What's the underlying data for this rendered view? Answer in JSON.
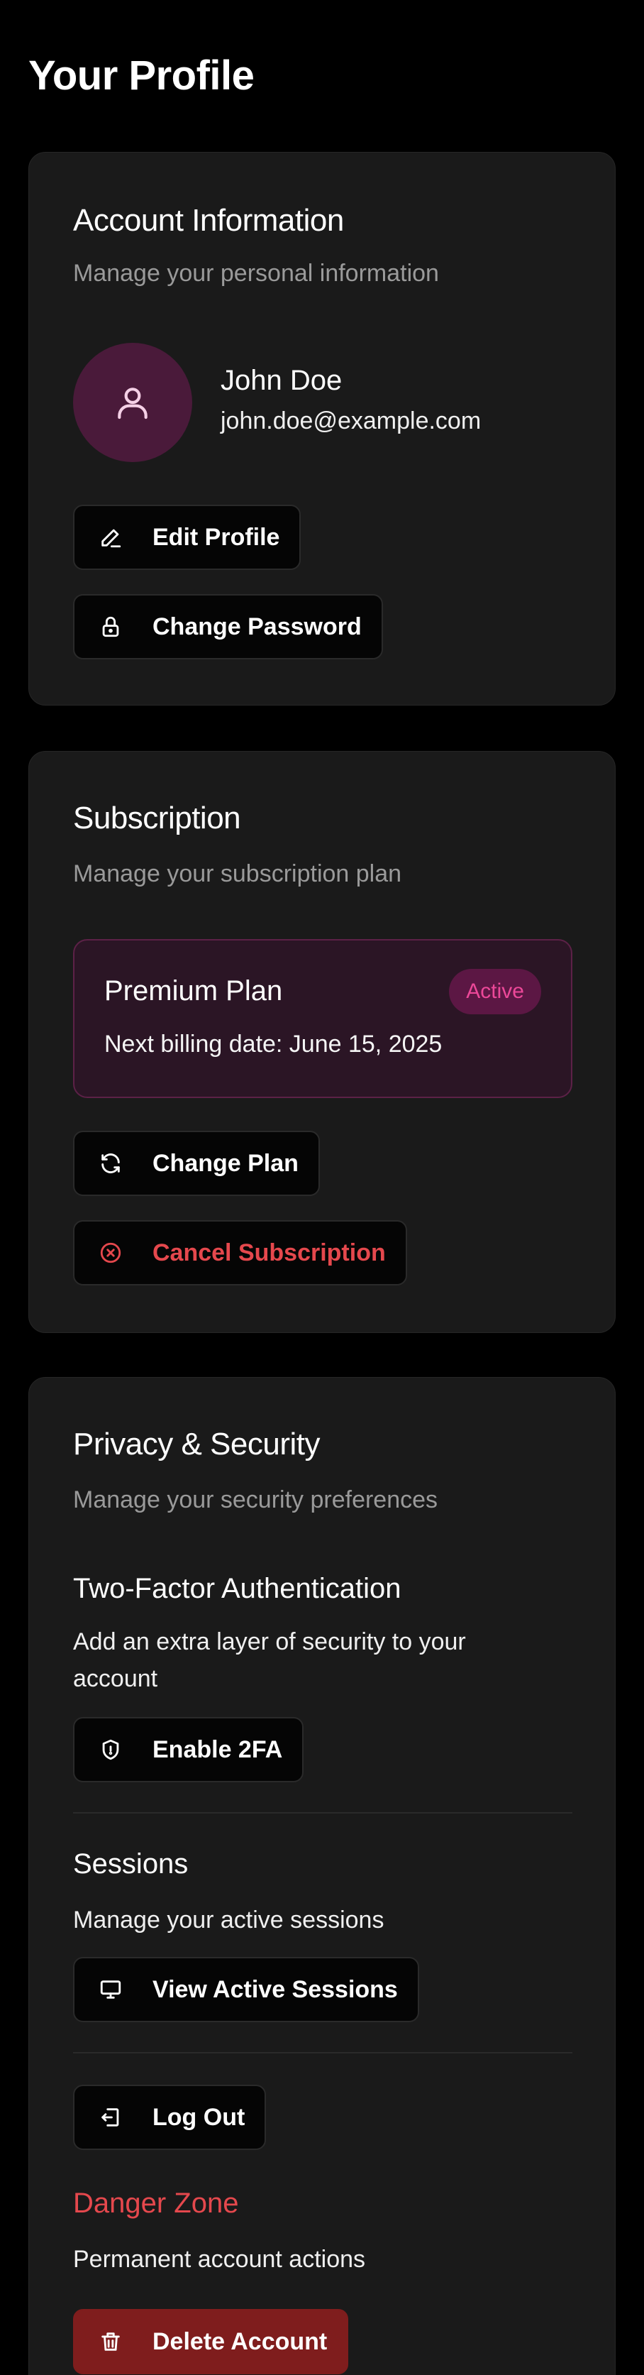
{
  "page": {
    "title": "Your Profile"
  },
  "account": {
    "title": "Account Information",
    "subtitle": "Manage your personal information",
    "name": "John Doe",
    "email": "john.doe@example.com",
    "edit_label": "Edit Profile",
    "password_label": "Change Password"
  },
  "subscription": {
    "title": "Subscription",
    "subtitle": "Manage your subscription plan",
    "plan_name": "Premium Plan",
    "status": "Active",
    "billing": "Next billing date: June 15, 2025",
    "change_label": "Change Plan",
    "cancel_label": "Cancel Subscription"
  },
  "privacy": {
    "title": "Privacy & Security",
    "subtitle": "Manage your security preferences",
    "twofa": {
      "title": "Two-Factor Authentication",
      "text": "Add an extra layer of security to your account",
      "button": "Enable 2FA"
    },
    "sessions": {
      "title": "Sessions",
      "text": "Manage your active sessions",
      "button": "View Active Sessions"
    },
    "logout_label": "Log Out",
    "danger": {
      "title": "Danger Zone",
      "text": "Permanent account actions",
      "button": "Delete Account"
    }
  },
  "colors": {
    "background": "#000000",
    "card": "#1a1a1a",
    "accent_pink": "#ec4899",
    "danger": "#e5484d",
    "danger_fill": "#7f1d1d"
  },
  "icons": {
    "avatar": "user-icon",
    "edit": "pencil-icon",
    "password": "lock-icon",
    "change_plan": "refresh-icon",
    "cancel": "x-circle-icon",
    "twofa": "shield-icon",
    "sessions": "monitor-icon",
    "logout": "logout-icon",
    "delete": "trash-icon"
  }
}
